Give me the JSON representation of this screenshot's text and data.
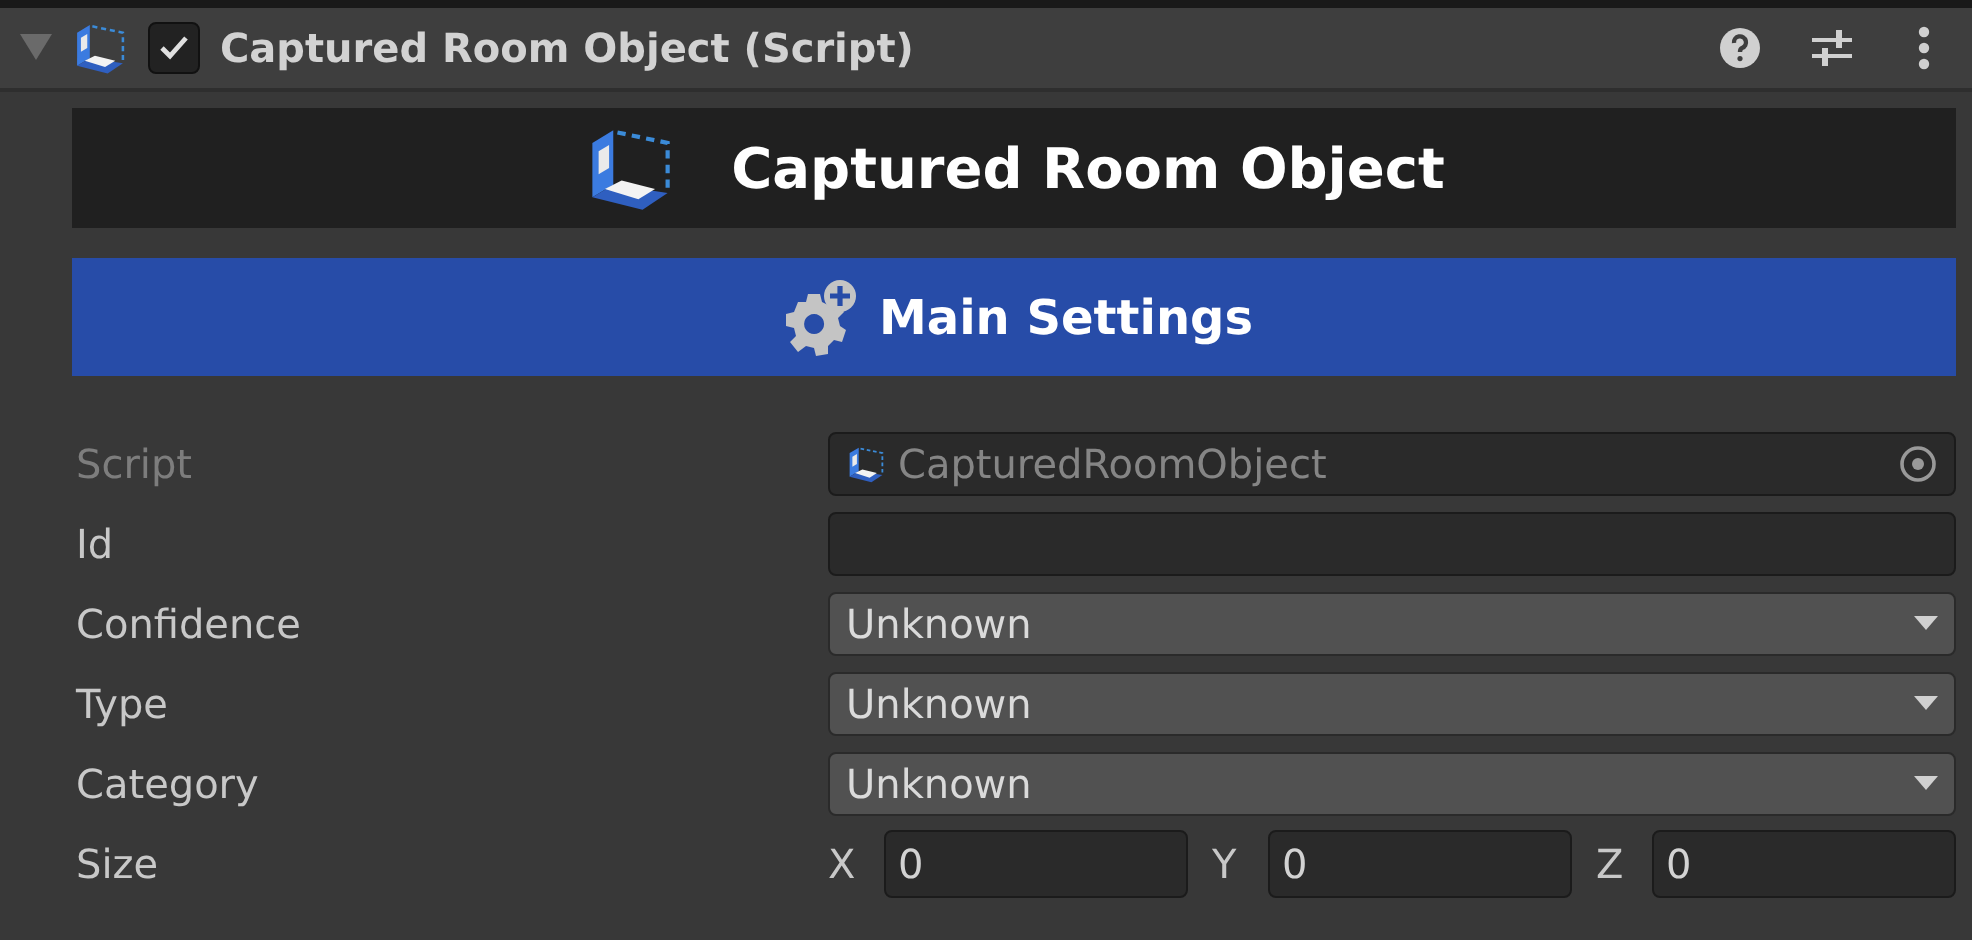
{
  "component": {
    "title": "Captured Room Object (Script)",
    "expanded": true,
    "enabled": true
  },
  "banner": {
    "title": "Captured Room Object"
  },
  "section": {
    "title": "Main Settings"
  },
  "fields": [
    {
      "kind": "object",
      "label": "Script",
      "value": "CapturedRoomObject",
      "disabled": true
    },
    {
      "kind": "text",
      "label": "Id",
      "disabled": false
    },
    {
      "kind": "dropdown",
      "label": "Confidence",
      "value": "Unknown",
      "disabled": false
    },
    {
      "kind": "dropdown",
      "label": "Type",
      "value": "Unknown",
      "disabled": false
    },
    {
      "kind": "dropdown",
      "label": "Category",
      "value": "Unknown",
      "disabled": false
    },
    {
      "kind": "vector",
      "label": "Size",
      "disabled": false,
      "components": [
        {
          "axis": "X",
          "value": "0"
        },
        {
          "axis": "Y",
          "value": "0"
        },
        {
          "axis": "Z",
          "value": "0"
        }
      ]
    }
  ]
}
